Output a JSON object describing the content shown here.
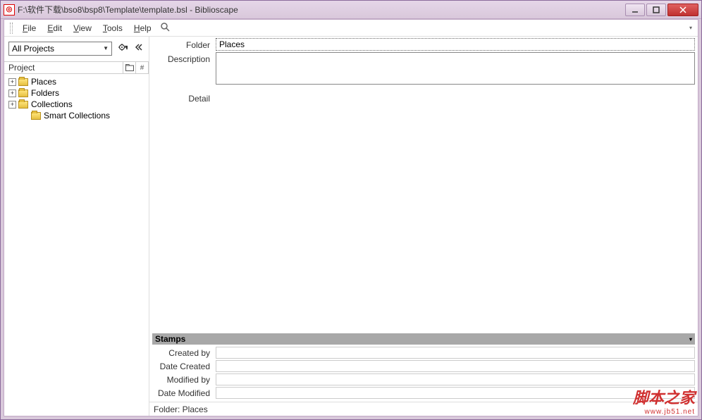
{
  "titlebar": {
    "path": "F:\\软件下载\\bso8\\bsp8\\Template\\template.bsl - Biblioscape"
  },
  "menu": {
    "file": "File",
    "edit": "Edit",
    "view": "View",
    "tools": "Tools",
    "help": "Help"
  },
  "sidebar": {
    "selector_value": "All Projects",
    "header_label": "Project",
    "nodes": [
      {
        "label": "Places",
        "expandable": true
      },
      {
        "label": "Folders",
        "expandable": true
      },
      {
        "label": "Collections",
        "expandable": true
      },
      {
        "label": "Smart Collections",
        "expandable": false
      }
    ]
  },
  "fields": {
    "folder_label": "Folder",
    "folder_value": "Places",
    "description_label": "Description",
    "detail_label": "Detail"
  },
  "stamps": {
    "header": "Stamps",
    "created_by_label": "Created by",
    "date_created_label": "Date Created",
    "modified_by_label": "Modified by",
    "date_modified_label": "Date Modified"
  },
  "statusbar": {
    "text": "Folder: Places"
  },
  "watermark": {
    "cn": "脚本之家",
    "url": "www.jb51.net"
  }
}
